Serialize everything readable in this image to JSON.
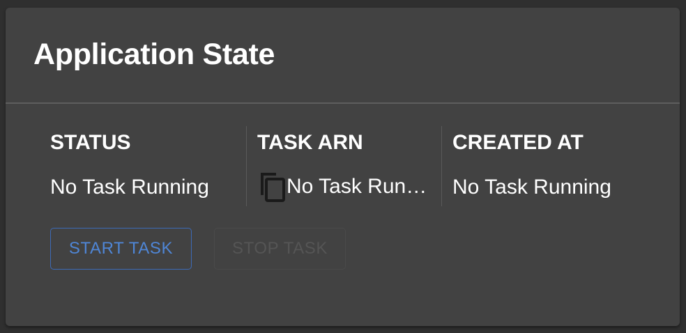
{
  "card": {
    "title": "Application State"
  },
  "columns": [
    {
      "header": "STATUS",
      "value": "No Task Running"
    },
    {
      "header": "TASK ARN",
      "value": "No Task Running",
      "icon": "copy-icon"
    },
    {
      "header": "CREATED AT",
      "value": "No Task Running"
    }
  ],
  "buttons": {
    "start_label": "START TASK",
    "stop_label": "STOP TASK",
    "stop_disabled": true
  },
  "colors": {
    "card_background": "#424242",
    "page_background": "#2f2f2f",
    "accent": "#4f86d6",
    "text": "#ffffff"
  }
}
